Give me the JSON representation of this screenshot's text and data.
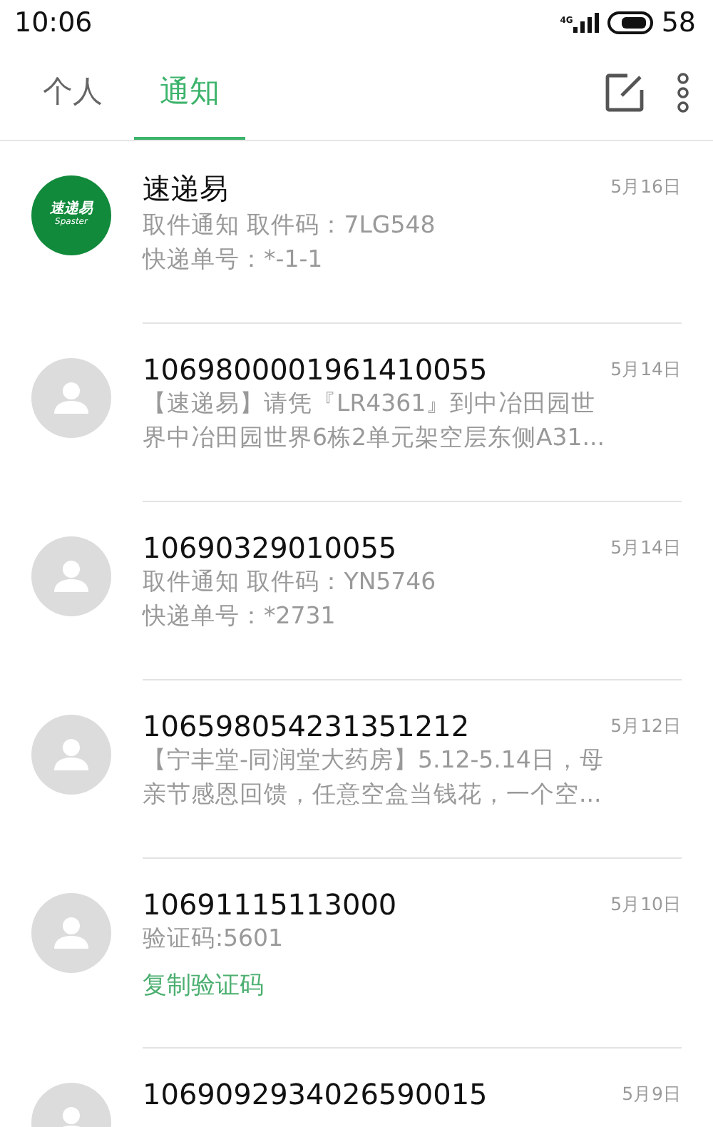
{
  "status_bar": {
    "time": "10:06",
    "network": "4G",
    "battery": "58"
  },
  "tabs": [
    {
      "label": "个人",
      "selected": false
    },
    {
      "label": "通知",
      "selected": true
    }
  ],
  "messages": [
    {
      "avatar": {
        "kind": "logo",
        "text": "速递易",
        "subtext": "Spaster"
      },
      "name": "速递易",
      "date": "5月16日",
      "preview": [
        "取件通知 取件码：7LG548",
        "快递单号：*-1-1"
      ]
    },
    {
      "avatar": {
        "kind": "person"
      },
      "name": "1069800001961410055",
      "date": "5月14日",
      "preview": [
        "【速递易】请凭『LR4361』到中冶田园世",
        "界中冶田园世界6栋2单元架空层东侧A31..."
      ]
    },
    {
      "avatar": {
        "kind": "person"
      },
      "name": "10690329010055",
      "date": "5月14日",
      "preview": [
        "取件通知 取件码：YN5746",
        "快递单号：*2731"
      ]
    },
    {
      "avatar": {
        "kind": "person"
      },
      "name": "106598054231351212",
      "date": "5月12日",
      "preview": [
        "【宁丰堂-同润堂大药房】5.12-5.14日，母",
        "亲节感恩回馈，任意空盒当钱花，一个空..."
      ]
    },
    {
      "avatar": {
        "kind": "person"
      },
      "name": "10691115113000",
      "date": "5月10日",
      "preview": [
        "验证码:5601"
      ],
      "action": "复制验证码"
    },
    {
      "avatar": {
        "kind": "person"
      },
      "name": "1069092934026590015",
      "date": "5月9日"
    }
  ]
}
